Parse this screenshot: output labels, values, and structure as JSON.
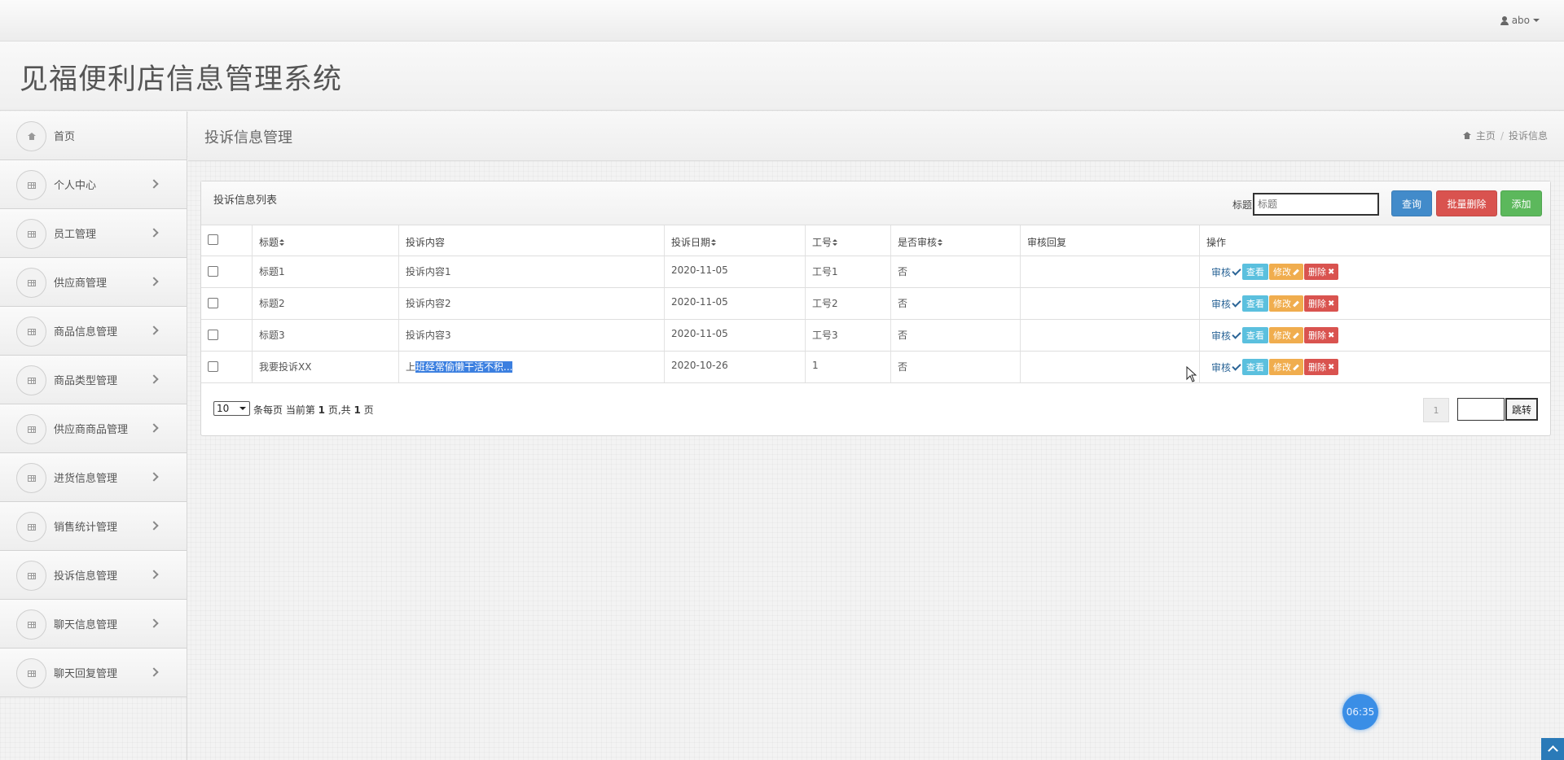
{
  "topbar": {
    "user_name": "abo"
  },
  "app": {
    "title": "见福便利店信息管理系统"
  },
  "sidebar": {
    "items": [
      {
        "label": "首页",
        "icon": "home-icon",
        "has_chevron": false
      },
      {
        "label": "个人中心",
        "icon": "grid-icon",
        "has_chevron": true
      },
      {
        "label": "员工管理",
        "icon": "grid-icon",
        "has_chevron": true
      },
      {
        "label": "供应商管理",
        "icon": "grid-icon",
        "has_chevron": true
      },
      {
        "label": "商品信息管理",
        "icon": "grid-icon",
        "has_chevron": true
      },
      {
        "label": "商品类型管理",
        "icon": "grid-icon",
        "has_chevron": true
      },
      {
        "label": "供应商商品管理",
        "icon": "grid-icon",
        "has_chevron": true
      },
      {
        "label": "进货信息管理",
        "icon": "grid-icon",
        "has_chevron": true
      },
      {
        "label": "销售统计管理",
        "icon": "grid-icon",
        "has_chevron": true
      },
      {
        "label": "投诉信息管理",
        "icon": "grid-icon",
        "has_chevron": true
      },
      {
        "label": "聊天信息管理",
        "icon": "grid-icon",
        "has_chevron": true
      },
      {
        "label": "聊天回复管理",
        "icon": "grid-icon",
        "has_chevron": true
      }
    ]
  },
  "content": {
    "page_title": "投诉信息管理",
    "breadcrumb": {
      "home": "主页",
      "separator": "/",
      "current": "投诉信息"
    }
  },
  "panel": {
    "title": "投诉信息列表",
    "search": {
      "label": "标题",
      "placeholder": "标题",
      "value": ""
    },
    "buttons": {
      "query": "查询",
      "batch_delete": "批量删除",
      "add": "添加"
    }
  },
  "table": {
    "headers": {
      "title": "标题",
      "content": "投诉内容",
      "date": "投诉日期",
      "employee_no": "工号",
      "reviewed": "是否审核",
      "review_reply": "审核回复",
      "actions": "操作"
    },
    "rows": [
      {
        "title": "标题1",
        "content_a": "投诉内容1",
        "content_b": "",
        "date": "2020-11-05",
        "employee_no": "工号1",
        "reviewed": "否",
        "review_reply": ""
      },
      {
        "title": "标题2",
        "content_a": "投诉内容2",
        "content_b": "",
        "date": "2020-11-05",
        "employee_no": "工号2",
        "reviewed": "否",
        "review_reply": ""
      },
      {
        "title": "标题3",
        "content_a": "投诉内容3",
        "content_b": "",
        "date": "2020-11-05",
        "employee_no": "工号3",
        "reviewed": "否",
        "review_reply": ""
      },
      {
        "title": "我要投诉XX",
        "content_a": "上",
        "content_b": "班经常偷懒干活不积...",
        "date": "2020-10-26",
        "employee_no": "1",
        "reviewed": "否",
        "review_reply": ""
      }
    ],
    "row_actions": {
      "audit": "审核",
      "view": "查看",
      "edit": "修改",
      "delete": "删除"
    }
  },
  "pagination": {
    "page_size": "10",
    "info_prefix": "条每页 当前第 ",
    "current_page": "1",
    "info_middle": " 页,共 ",
    "total_pages": "1",
    "info_suffix": " 页",
    "page_button": "1",
    "jump_label": "跳转"
  },
  "clock": {
    "time": "06:35"
  },
  "colors": {
    "primary": "#428bca",
    "danger": "#d9534f",
    "success": "#5cb85c",
    "info": "#5bc0de",
    "warning": "#f0ad4e"
  }
}
